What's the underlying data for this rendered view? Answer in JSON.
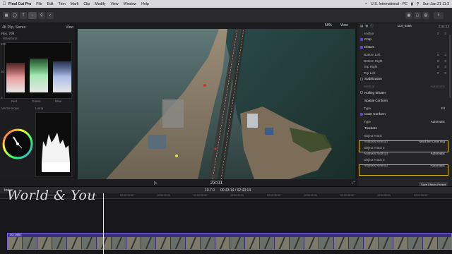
{
  "menubar": {
    "app": "Final Cut Pro",
    "items": [
      "File",
      "Edit",
      "Trim",
      "Mark",
      "Clip",
      "Modify",
      "View",
      "Window",
      "Help"
    ],
    "status_input": "U.S. International - PC",
    "clock": "Sun Jan 21 11:3"
  },
  "toolbar": {
    "zoom": "10.7.0"
  },
  "scopes": {
    "format": "4K 25p, Stereo",
    "view_label": "View",
    "rec": "Rec. 709",
    "waveform": "Waveform",
    "channels": [
      "Red",
      "Green",
      "Blue"
    ],
    "vectorscope": "Vectorscope",
    "luma": "Luma",
    "scale": [
      "100",
      "50",
      "0"
    ]
  },
  "viewer": {
    "zoom_pct": "59%",
    "view_label": "View",
    "timecode": "23:01"
  },
  "inspector": {
    "clip_name": "DJI_0486",
    "duration": "2:43:14",
    "rows": [
      {
        "label": "Anchor",
        "type": "xy",
        "x": "0",
        "y": "0"
      },
      {
        "label": "Crop",
        "type": "section",
        "enabled": true
      },
      {
        "label": "Distort",
        "type": "section",
        "enabled": true
      },
      {
        "label": "Bottom Left",
        "type": "xy",
        "x": "0",
        "y": "0"
      },
      {
        "label": "Bottom Right",
        "type": "xy",
        "x": "0",
        "y": "0"
      },
      {
        "label": "Top Right",
        "type": "xy",
        "x": "0",
        "y": "0"
      },
      {
        "label": "Top Left",
        "type": "xy",
        "x": "0",
        "y": "0"
      },
      {
        "label": "Stabilization",
        "type": "section",
        "enabled": false
      },
      {
        "label": "Method",
        "type": "value",
        "value": "Automatic",
        "dim": true
      },
      {
        "label": "Rolling Shutter",
        "type": "section",
        "enabled": false
      },
      {
        "label": "Spatial Conform",
        "type": "section",
        "enabled": null
      },
      {
        "label": "Type",
        "type": "value",
        "value": "Fit"
      },
      {
        "label": "Color Conform",
        "type": "section",
        "enabled": true
      },
      {
        "label": "Type",
        "type": "value",
        "value": "Automatic"
      },
      {
        "label": "Trackers",
        "type": "subsection"
      },
      {
        "label": "Object Track",
        "type": "value",
        "value": ""
      },
      {
        "label": "Analysis Method",
        "type": "value",
        "value": "Machine Learning"
      },
      {
        "label": "Object Track 2",
        "type": "value",
        "value": ""
      },
      {
        "label": "Analysis Method",
        "type": "value",
        "value": "Automatic"
      },
      {
        "label": "Object Track 3",
        "type": "value",
        "value": ""
      },
      {
        "label": "Analysis Method",
        "type": "value",
        "value": "Automatic"
      }
    ],
    "effects_button": "Save Effects Preset"
  },
  "timeline": {
    "index_label": "Index",
    "timecode": "10.7.0",
    "position": "00:43:14 / 02:43:14",
    "clip_label": "DJI_0486",
    "ruler": [
      "00:00:00:00",
      "00:00:05:00",
      "00:00:10:00",
      "00:00:15:00",
      "00:00:20:00",
      "00:00:25:00",
      "00:00:30:00",
      "00:00:35:00",
      "00:00:40:00",
      "00:00:45:00",
      "00:00:50:00",
      "00:00:55:00"
    ]
  },
  "watermark": "World & You",
  "colors": {
    "accent": "#5b48d8",
    "clip": "#3a2d7a",
    "highlight": "#d4b51a"
  }
}
